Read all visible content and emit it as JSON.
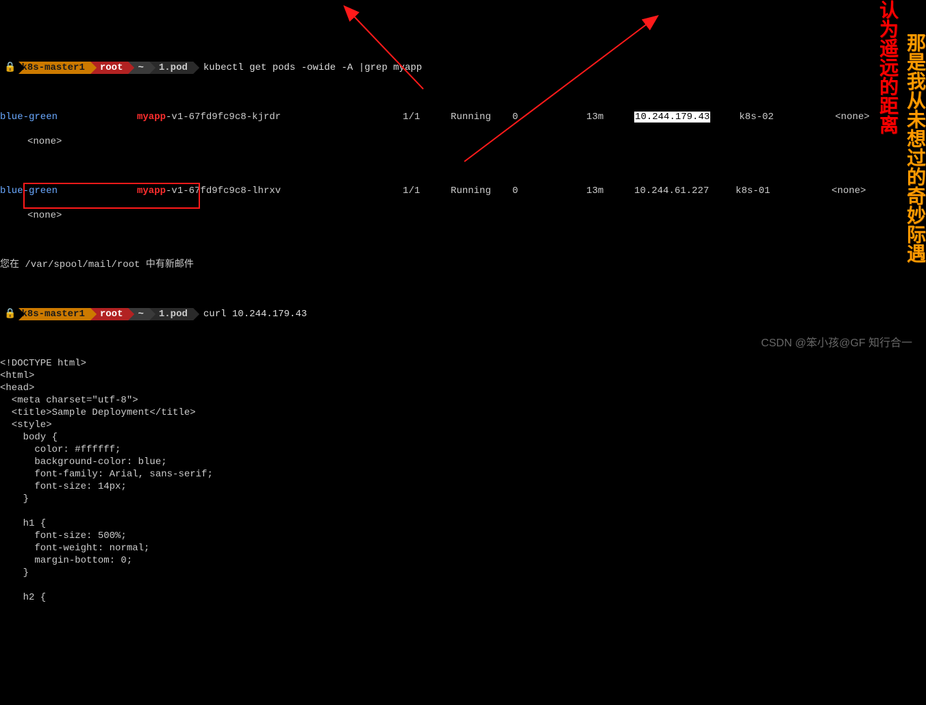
{
  "prompt1": {
    "host": "k8s-master1",
    "user": "root",
    "home": "~",
    "dir": "1.pod",
    "command": "kubectl get pods -owide -A |grep myapp"
  },
  "rows": [
    {
      "ns": "blue-green",
      "name_prefix": "myapp",
      "name_suffix": "-v1-67fd9fc9c8-kjrdr",
      "ready": "1/1",
      "status": "Running",
      "restarts": "0",
      "age": "13m",
      "ip": "10.244.179.43",
      "ip_highlight": true,
      "node": "k8s-02",
      "extra": "<none>"
    },
    {
      "ns": "blue-green",
      "name_prefix": "myapp",
      "name_suffix": "-v1-67fd9fc9c8-lhrxv",
      "ready": "1/1",
      "status": "Running",
      "restarts": "0",
      "age": "13m",
      "ip": "10.244.61.227",
      "ip_highlight": false,
      "node": "k8s-01",
      "extra": "<none>"
    }
  ],
  "row_tail": "<none>",
  "mail_notice": "您在 /var/spool/mail/root 中有新邮件",
  "prompt2": {
    "host": "k8s-master1",
    "user": "root",
    "home": "~",
    "dir": "1.pod",
    "command": "curl 10.244.179.43"
  },
  "html_output": [
    "<!DOCTYPE html>",
    "<html>",
    "<head>",
    "  <meta charset=\"utf-8\">",
    "  <title>Sample Deployment</title>",
    "  <style>",
    "    body {",
    "      color: #ffffff;",
    "      background-color: blue;",
    "      font-family: Arial, sans-serif;",
    "      font-size: 14px;",
    "    }",
    "",
    "    h1 {",
    "      font-size: 500%;",
    "      font-weight: normal;",
    "      margin-bottom: 0;",
    "    }",
    "",
    "    h2 {"
  ],
  "annotations": {
    "vertical_red": "认为遥远的距离",
    "vertical_orange": "那是我从未想过的奇妙际遇"
  },
  "csdn_watermark": "CSDN @笨小孩@GF 知行合一",
  "arrow_hint": "arrows pointing to command and highlighted IP"
}
